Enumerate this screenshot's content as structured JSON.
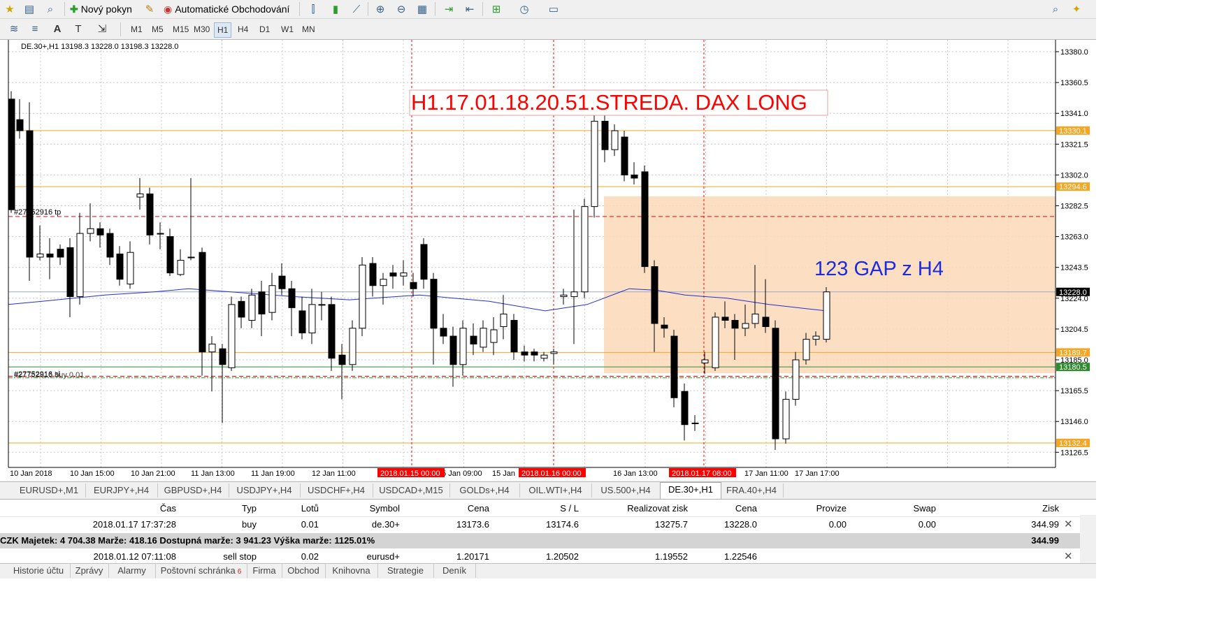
{
  "toolbar1": {
    "new_order_label": "Nový pokyn",
    "auto_trading_label": "Automatické Obchodování"
  },
  "timeframes": [
    "M1",
    "M5",
    "M15",
    "M30",
    "H1",
    "H4",
    "D1",
    "W1",
    "MN"
  ],
  "active_timeframe": "H1",
  "chart": {
    "header": "DE.30+,H1  13198.3 13228.0 13198.3 13228.0",
    "annotation_title": "H1.17.01.18.20.51.STREDA. DAX LONG",
    "annotation_gap": "123 GAP z H4",
    "tp_label": "#27752916 tp",
    "buy_label": "#27752916 sl",
    "buy_label2": "#27752916 buy 0.01",
    "price_ticks": [
      "13380.0",
      "13360.5",
      "13341.0",
      "13321.5",
      "13302.0",
      "13282.5",
      "13263.0",
      "13243.5",
      "13224.0",
      "13204.5",
      "13185.0",
      "13165.5",
      "13146.0",
      "13126.5"
    ],
    "level_labels": {
      "l13330": "13330.1",
      "l13294": "13294.6",
      "l13228": "13228.0",
      "l13189": "13189.7",
      "l13180": "13180.5",
      "l13132": "13132.4"
    },
    "time_labels": [
      "10 Jan 2018",
      "10 Jan 15:00",
      "10 Jan 21:00",
      "11 Jan 13:00",
      "11 Jan 19:00",
      "12 Jan 11:00",
      "15 Jan 09:00",
      "15 Jan",
      "16 Jan 13:00",
      "17 Jan 11:00",
      "17 Jan 17:00"
    ],
    "red_time_labels": [
      "2018.01.15 00:00",
      "2018.01.16 00:00",
      "2018.01.17 08:00"
    ],
    "colors": {
      "accent_red": "#ff0000",
      "ma_blue": "#2030d0",
      "gap_zone": "#fbd9b8",
      "level_orange": "#f5a623",
      "level_green": "#2e8b2e"
    }
  },
  "symbol_tabs": [
    "EURUSD+,M1",
    "EURJPY+,H4",
    "GBPUSD+,H4",
    "USDJPY+,H4",
    "USDCHF+,H4",
    "USDCAD+,M15",
    "GOLDs+,H4",
    "OIL.WTI+,H4",
    "US.500+,H4",
    "DE.30+,H1",
    "FRA.40+,H4"
  ],
  "active_symbol_tab": "DE.30+,H1",
  "terminal": {
    "headers": [
      "Čas",
      "Typ",
      "Lotů",
      "Symbol",
      "Cena",
      "S / L",
      "Realizovat zisk",
      "Cena",
      "Provize",
      "Swap",
      "Zisk"
    ],
    "row1": [
      "2018.01.17 17:37:28",
      "buy",
      "0.01",
      "de.30+",
      "13173.6",
      "13174.6",
      "13275.7",
      "13228.0",
      "0.00",
      "0.00",
      "344.99"
    ],
    "summary": "CZK  Majetek: 4 704.38  Marže: 418.16  Dostupná marže: 3 941.23  Výška marže: 1125.01%",
    "summary_profit": "344.99",
    "row2": [
      "2018.01.12 07:11:08",
      "sell stop",
      "0.02",
      "eurusd+",
      "1.20171",
      "1.20502",
      "1.19552",
      "1.22546"
    ]
  },
  "bottom_tabs": [
    "Historie účtu",
    "Zprávy",
    "Alarmy",
    "Poštovní schránka",
    "Firma",
    "Obchod",
    "Knihovna",
    "Strategie",
    "Deník"
  ],
  "mailbox_badge": "6"
}
